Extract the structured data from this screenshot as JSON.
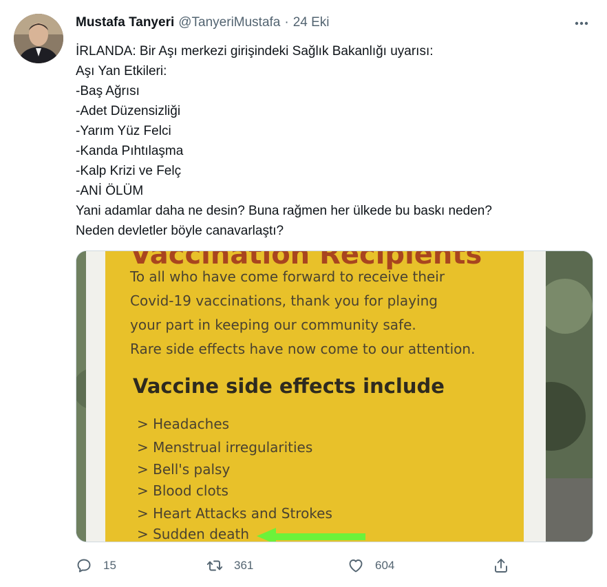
{
  "author": {
    "name": "Mustafa Tanyeri",
    "handle": "@TanyeriMustafa",
    "separator": "·",
    "date": "24 Eki",
    "avatar_icon": "user-avatar-photo"
  },
  "tweet": {
    "lines": [
      "İRLANDA: Bir Aşı merkezi girişindeki Sağlık Bakanlığı uyarısı:",
      "Aşı Yan Etkileri:",
      "-Baş Ağrısı",
      "-Adet Düzensizliği",
      "-Yarım Yüz Felci",
      "-Kanda Pıhtılaşma",
      "-Kalp Krizi ve Felç",
      "-ANİ ÖLÜM",
      "Yani adamlar daha ne desin? Buna rağmen her ülkede bu baskı neden?",
      "Neden devletler böyle canavarlaştı?"
    ]
  },
  "media": {
    "sign": {
      "title_partial": "Vaccination Recipients",
      "intro_lines": [
        "To all who have come forward to receive their",
        "Covid-19 vaccinations, thank you for playing",
        "your part in keeping our community safe.",
        "Rare side effects have now come to our attention."
      ],
      "heading": "Vaccine side effects include",
      "items": [
        "> Headaches",
        "> Menstrual irregularities",
        "> Bell's palsy",
        "> Blood clots",
        "> Heart Attacks and Strokes",
        "> Sudden death"
      ]
    },
    "colors": {
      "sign_yellow": "#e8c12a",
      "arrow_green": "#6cf23a"
    }
  },
  "actions": {
    "reply_count": "15",
    "retweet_count": "361",
    "like_count": "604",
    "reply_icon": "reply-icon",
    "retweet_icon": "retweet-icon",
    "like_icon": "heart-icon",
    "share_icon": "share-icon",
    "more_icon": "more-dots-icon"
  }
}
